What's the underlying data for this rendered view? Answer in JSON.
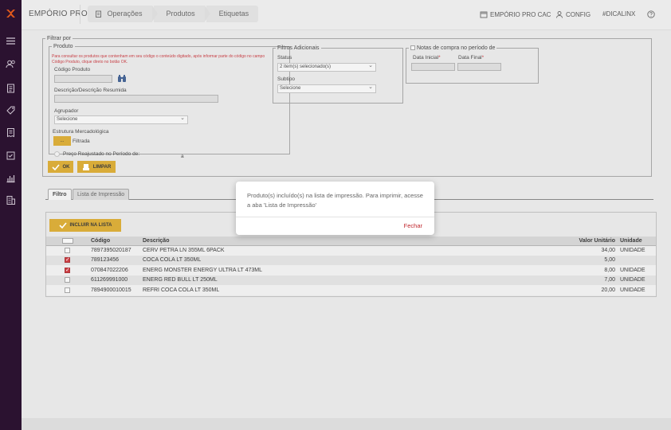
{
  "app": {
    "brand": "EMPÓRIO PRO"
  },
  "header": {
    "crumbs": [
      "Operações",
      "Produtos",
      "Etiquetas"
    ],
    "right": [
      "EMPÓRIO PRO CAC",
      "CONFIG",
      "#DICALINX"
    ]
  },
  "rail": {
    "icons": [
      "menu-icon",
      "users-icon",
      "clipboard-icon",
      "tag-icon",
      "receipt-icon",
      "checklist-icon",
      "chart-icon",
      "building-icon"
    ]
  },
  "filter": {
    "legend": "Filtrar por",
    "produto": {
      "legend": "Produto",
      "warning": "Para consultar os produtos que contenham em seu código o conteúdo digitado, após informar parte do código no campo Código Produto, clique direto no botão OK.",
      "codigo_label": "Código Produto",
      "descricao_label": "Descrição/Descrição Resumida",
      "agrupador_label": "Agrupador",
      "agrupador_value": "Selecione",
      "estrutura_label": "Estrutura Mercadológica",
      "filtrada_label": "Filtrada",
      "estrutura_btn": "...",
      "preco_label": "Preço Reajustado no Período de:",
      "preco_suffix": "a"
    },
    "adicionais": {
      "legend": "Filtros Adicionais",
      "status_label": "Status",
      "status_value": "2 item(s) selecionado(s)",
      "subtipo_label": "Subtipo",
      "subtipo_value": "Selecione"
    },
    "notas": {
      "legend": "Notas de compra no período de",
      "data_inicial": "Data Inicial",
      "data_final": "Data Final",
      "req": "*"
    },
    "ok_label": "OK",
    "limpar_label": "LIMPAR"
  },
  "tabs": [
    "Filtro",
    "Lista de Impressão"
  ],
  "list": {
    "incluir_label": "INCLUIR NA LISTA",
    "columns": [
      "Código",
      "Descrição",
      "Valor Unitário",
      "Unidade"
    ],
    "rows": [
      {
        "checked": false,
        "codigo": "7897395020187",
        "descricao": "CERV PETRA LN 355ML 6PACK",
        "valor": "34,00",
        "unidade": "UNIDADE"
      },
      {
        "checked": true,
        "codigo": "789123456",
        "descricao": "COCA COLA LT 350ML",
        "valor": "5,00",
        "unidade": ""
      },
      {
        "checked": true,
        "codigo": "070847022206",
        "descricao": "ENERG MONSTER ENERGY ULTRA LT 473ML",
        "valor": "8,00",
        "unidade": "UNIDADE"
      },
      {
        "checked": false,
        "codigo": "611269991000",
        "descricao": "ENERG RED BULL LT 250ML",
        "valor": "7,00",
        "unidade": "UNIDADE"
      },
      {
        "checked": false,
        "codigo": "7894900010015",
        "descricao": "REFRI COCA COLA LT 350ML",
        "valor": "20,00",
        "unidade": "UNIDADE"
      }
    ]
  },
  "modal": {
    "message": "Produto(s) incluído(s) na lista de impressão. Para imprimir, acesse a aba 'Lista de Impressão'",
    "close_label": "Fechar"
  },
  "colors": {
    "accent": "#d4a11e",
    "danger": "#c0262d",
    "rail": "#2b1230"
  }
}
